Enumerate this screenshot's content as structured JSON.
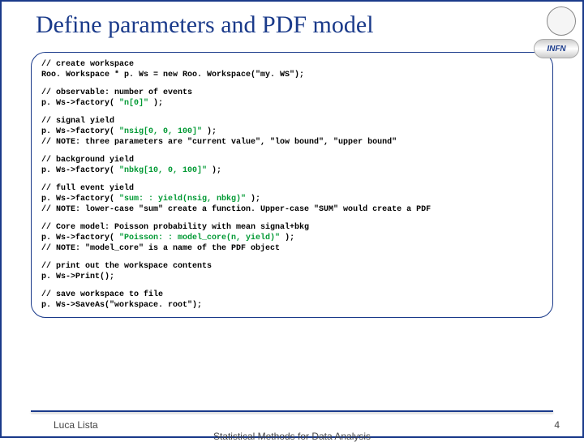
{
  "title": "Define parameters and PDF model",
  "logos": {
    "top": "seal",
    "infn": "INFN"
  },
  "code": {
    "b1c": "// create workspace",
    "b1l": "Roo. Workspace * p. Ws = new Roo. Workspace(\"my. WS\");",
    "b2c": "// observable: number of events",
    "b2l": "p. Ws->factory( \"n[0]\" );",
    "b3c": "// signal yield",
    "b3l1": "p. Ws->factory( \"nsig[0, 0, 100]\" );",
    "b3l2": "// NOTE: three parameters are \"current value\", \"low bound\", \"upper bound\"",
    "b4c": "// background yield",
    "b4l": "p. Ws->factory( \"nbkg[10, 0, 100]\" );",
    "b5c": "// full event yield",
    "b5l1": "p. Ws->factory( \"sum: : yield(nsig, nbkg)\" );",
    "b5l2": "// NOTE: lower-case \"sum\" create a function. Upper-case \"SUM\" would create a PDF",
    "b6c": "// Core model: Poisson probability with mean signal+bkg",
    "b6l1": "p. Ws->factory( \"Poisson: : model_core(n, yield)\" );",
    "b6l2": "// NOTE: \"model_core\" is a name of the PDF object",
    "b7c": "// print out the workspace contents",
    "b7l": "p. Ws->Print();",
    "b8c": "// save workspace to file",
    "b8l": "p. Ws->SaveAs(\"workspace. root\");"
  },
  "footer": {
    "author": "Luca Lista",
    "mid": "Statistical Methods for Data Analysis",
    "num": "4"
  }
}
